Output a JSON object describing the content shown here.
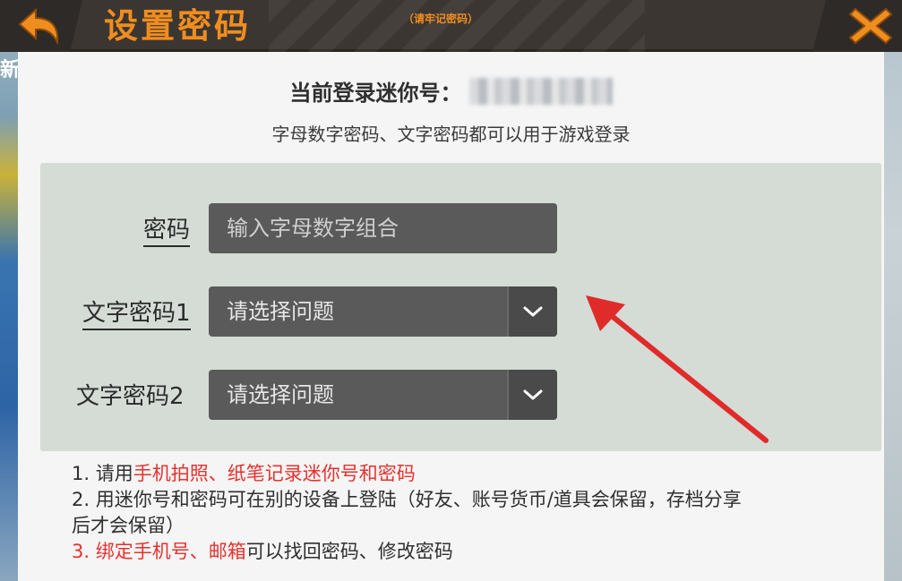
{
  "background": {
    "left_text": "新"
  },
  "header": {
    "title": "设置密码",
    "subtitle": "（请牢记密码）",
    "back_icon": "back-arrow-icon",
    "close_icon": "close-icon",
    "accent_color": "#f08d1f"
  },
  "account": {
    "label": "当前登录迷你号：",
    "info": "字母数字密码、文字密码都可以用于游戏登录"
  },
  "form": {
    "password": {
      "label": "密码",
      "placeholder": "输入字母数字组合"
    },
    "text_password_1": {
      "label": "文字密码1",
      "selected": "请选择问题"
    },
    "text_password_2": {
      "label": "文字密码2",
      "selected": "请选择问题"
    }
  },
  "notes": {
    "n1_prefix": "1. 请用",
    "n1_red": "手机拍照、纸笔记录迷你号和密码",
    "n2_line1": "2. 用迷你号和密码可在别的设备上登陆（好友、账号货币/道具会保留，存档分享",
    "n2_line2": "后才会保留）",
    "n3_prefix": "3. ",
    "n3_red1": "绑定手机号",
    "n3_sep": "、",
    "n3_red2": "邮箱",
    "n3_suffix": "可以找回密码、修改密码",
    "red_color": "#e5322f"
  }
}
